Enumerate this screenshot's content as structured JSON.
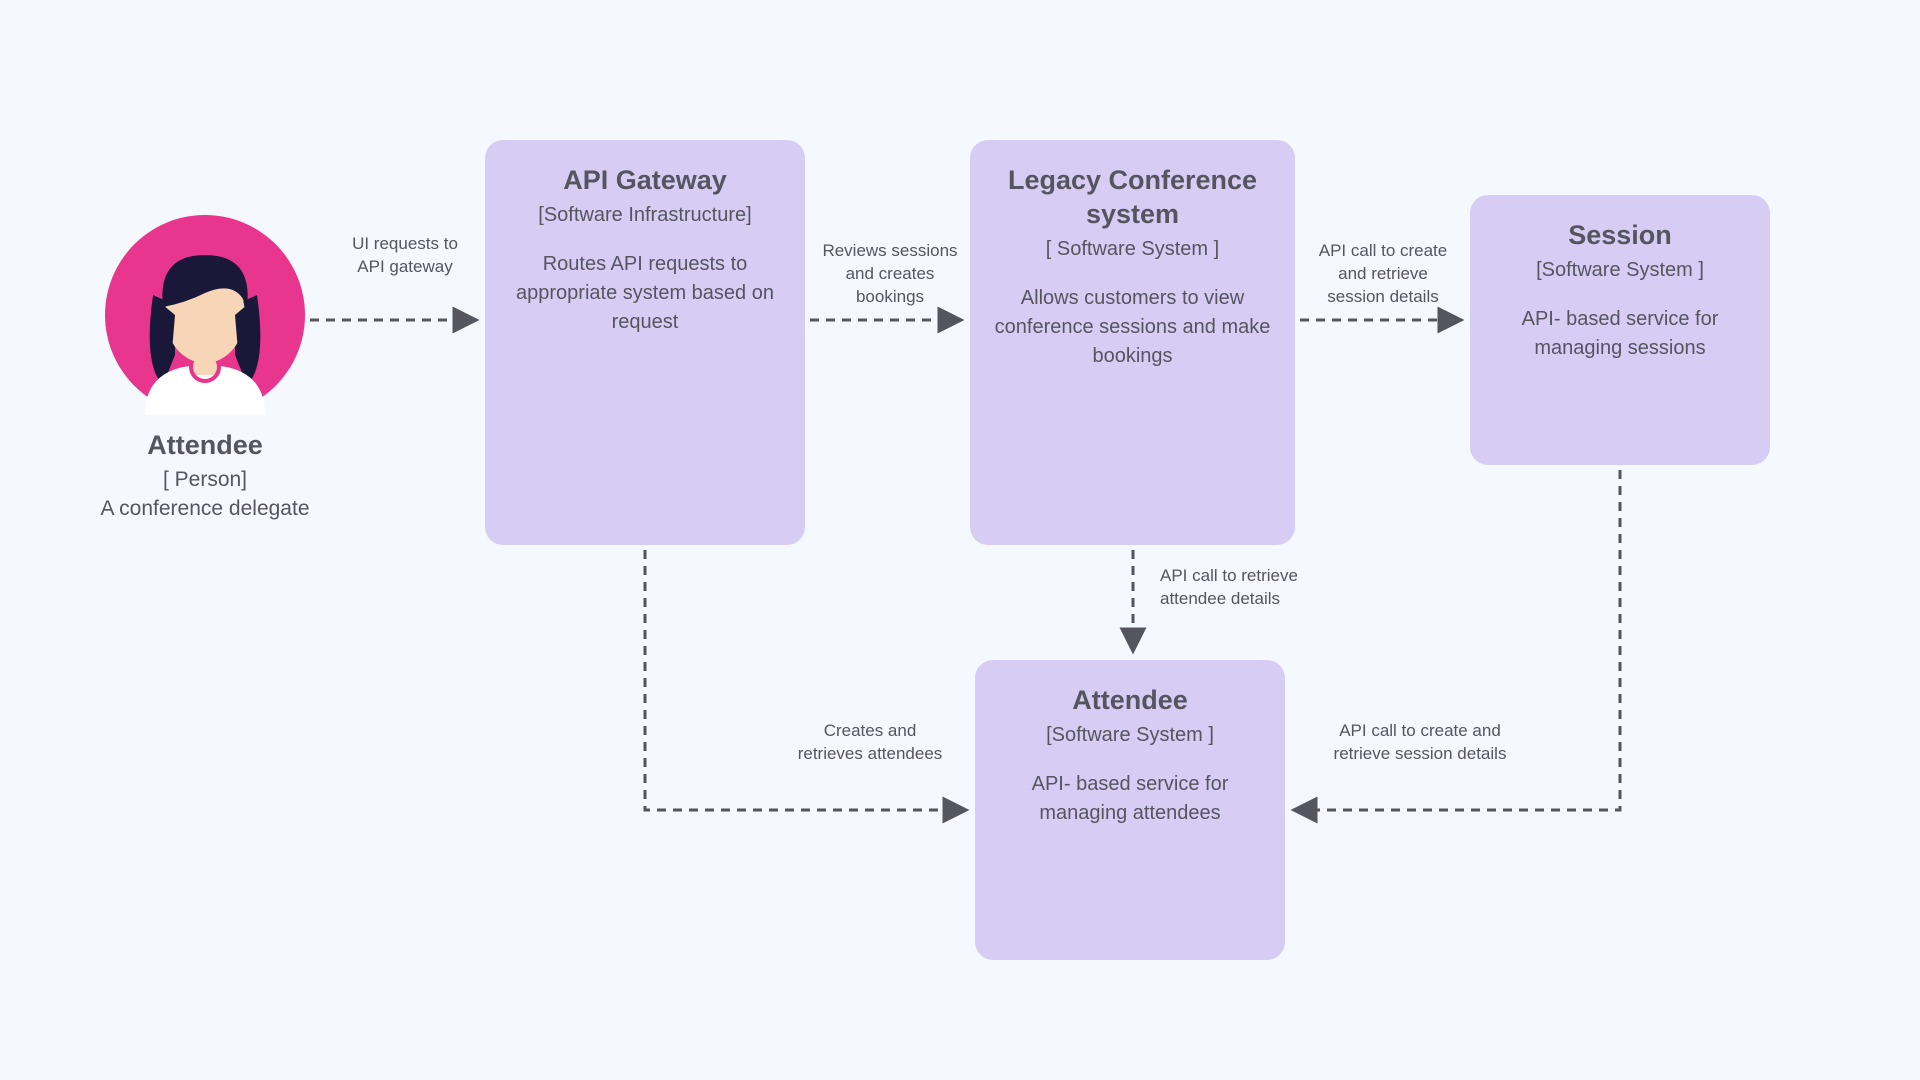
{
  "person": {
    "title": "Attendee",
    "subtitle": "[ Person]",
    "desc": "A conference  delegate"
  },
  "nodes": {
    "api_gateway": {
      "title": "API Gateway",
      "subtitle": "[Software Infrastructure]",
      "desc": "Routes API requests to appropriate system based on request"
    },
    "legacy": {
      "title": "Legacy Conference system",
      "subtitle": "[ Software System ]",
      "desc": "Allows customers to view conference  sessions and make bookings"
    },
    "session": {
      "title": "Session",
      "subtitle": "[Software System ]",
      "desc": "API- based service for managing sessions"
    },
    "attendee_svc": {
      "title": "Attendee",
      "subtitle": "[Software System ]",
      "desc": "API- based service  for managing  attendees"
    }
  },
  "edges": {
    "ui_to_api": "UI requests to\nAPI gateway",
    "api_to_legacy": "Reviews sessions\nand creates\nbookings",
    "legacy_to_session": "API call to create\nand retrieve\nsession details",
    "legacy_to_attendee": "API call to retrieve\nattendee details",
    "api_to_attendee": "Creates and\nretrieves attendees",
    "session_to_attendee": "API call to create and\nretrieve session details"
  }
}
